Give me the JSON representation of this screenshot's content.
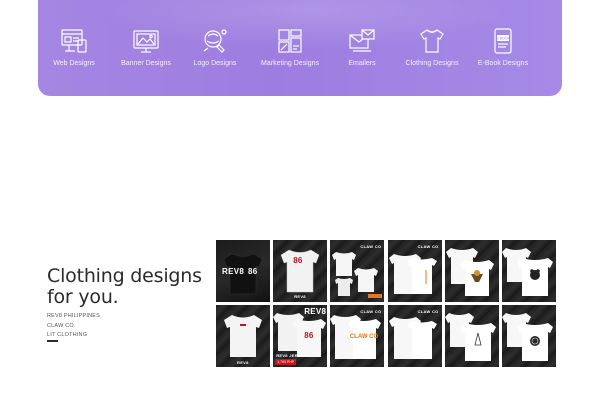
{
  "categories": [
    {
      "label": "Web Designs",
      "icon": "web-design-icon"
    },
    {
      "label": "Banner Designs",
      "icon": "banner-design-icon"
    },
    {
      "label": "Logo Designs",
      "icon": "logo-design-icon"
    },
    {
      "label": "Marketing Designs",
      "icon": "marketing-design-icon"
    },
    {
      "label": "Emailers",
      "icon": "emailer-icon"
    },
    {
      "label": "Clothing Designs",
      "icon": "tshirt-icon"
    },
    {
      "label": "E-Book Designs",
      "icon": "ebook-icon"
    }
  ],
  "ebook_icon_text": "E-BOOK",
  "section": {
    "heading_line1": "Clothing designs",
    "heading_line2": "for you.",
    "brands": [
      "REV8 PHILIPPINES",
      "CLAW CO.",
      "LIT CLOTHING"
    ]
  },
  "gallery": {
    "rev8": "REV8",
    "number": "86",
    "clawco": "CLAW CO",
    "rev8_jersey": "REV8 JERSEY",
    "price": "1,799 PHP",
    "tiles": [
      {
        "name": "rev8-jersey-back-black"
      },
      {
        "name": "rev8-jersey-back-white"
      },
      {
        "name": "clawco-shirt-set"
      },
      {
        "name": "clawco-shirt-pair"
      },
      {
        "name": "lit-shirt-emblem"
      },
      {
        "name": "lit-shirt-bear"
      },
      {
        "name": "rev8-shirt-front"
      },
      {
        "name": "rev8-jersey-promo"
      },
      {
        "name": "clawco-shirt-print"
      },
      {
        "name": "clawco-shirt-plain"
      },
      {
        "name": "lit-shirt-pendant"
      },
      {
        "name": "lit-shirt-badge"
      }
    ]
  },
  "colors": {
    "banner": "#a586e3",
    "heading": "#2b2b2b",
    "accent_red": "#c4161c"
  }
}
